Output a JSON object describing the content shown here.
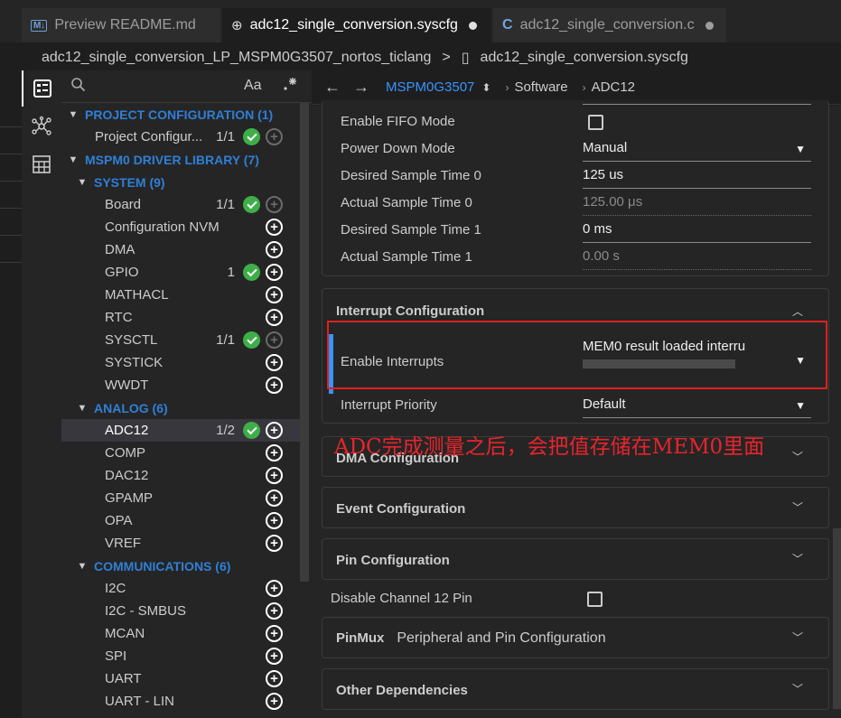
{
  "tabs": [
    {
      "label": "Preview README.md",
      "icon": "markdown-icon",
      "active": false
    },
    {
      "label": "adc12_single_conversion.syscfg",
      "icon": "globe-icon",
      "active": true,
      "modified": true
    },
    {
      "label": "adc12_single_conversion.c",
      "icon": "c-file-icon",
      "active": false,
      "modified": true
    }
  ],
  "breadcrumb": {
    "folder": "adc12_single_conversion_LP_MSPM0G3507_nortos_ticlang",
    "separator": ">",
    "file": "adc12_single_conversion.syscfg"
  },
  "sidebar": {
    "search_placeholder": "",
    "match_case_label": "Aa",
    "tree": [
      {
        "label": "PROJECT CONFIGURATION (1)",
        "type": "header",
        "level": 0,
        "expanded": true
      },
      {
        "label": "Project Configur...",
        "level": 1,
        "count": "1/1",
        "ok": true,
        "plus_dim": true
      },
      {
        "label": "MSPM0 DRIVER LIBRARY (7)",
        "type": "header",
        "level": 0,
        "expanded": true
      },
      {
        "label": "SYSTEM (9)",
        "type": "header",
        "level": 1,
        "expanded": true
      },
      {
        "label": "Board",
        "level": 2,
        "count": "1/1",
        "ok": true,
        "plus_dim": true
      },
      {
        "label": "Configuration NVM",
        "level": 2
      },
      {
        "label": "DMA",
        "level": 2
      },
      {
        "label": "GPIO",
        "level": 2,
        "count": "1",
        "ok": true
      },
      {
        "label": "MATHACL",
        "level": 2
      },
      {
        "label": "RTC",
        "level": 2
      },
      {
        "label": "SYSCTL",
        "level": 2,
        "count": "1/1",
        "ok": true,
        "plus_dim": true
      },
      {
        "label": "SYSTICK",
        "level": 2
      },
      {
        "label": "WWDT",
        "level": 2
      },
      {
        "label": "ANALOG (6)",
        "type": "header",
        "level": 1,
        "expanded": true
      },
      {
        "label": "ADC12",
        "level": 2,
        "count": "1/2",
        "ok": true,
        "selected": true
      },
      {
        "label": "COMP",
        "level": 2
      },
      {
        "label": "DAC12",
        "level": 2
      },
      {
        "label": "GPAMP",
        "level": 2
      },
      {
        "label": "OPA",
        "level": 2
      },
      {
        "label": "VREF",
        "level": 2
      },
      {
        "label": "COMMUNICATIONS (6)",
        "type": "header",
        "level": 1,
        "expanded": true
      },
      {
        "label": "I2C",
        "level": 2
      },
      {
        "label": "I2C - SMBUS",
        "level": 2
      },
      {
        "label": "MCAN",
        "level": 2
      },
      {
        "label": "SPI",
        "level": 2
      },
      {
        "label": "UART",
        "level": 2
      },
      {
        "label": "UART - LIN",
        "level": 2
      }
    ]
  },
  "toolbar": {
    "device": "MSPM0G3507",
    "crumb1": "Software",
    "crumb2": "ADC12"
  },
  "adc_fields": [
    {
      "label": "Enable FIFO Mode",
      "kind": "checkbox",
      "checked": false
    },
    {
      "label": "Power Down Mode",
      "kind": "dropdown",
      "value": "Manual"
    },
    {
      "label": "Desired Sample Time 0",
      "kind": "input",
      "value": "125 us"
    },
    {
      "label": "Actual Sample Time 0",
      "kind": "readonly",
      "value": "125.00 μs"
    },
    {
      "label": "Desired Sample Time 1",
      "kind": "input",
      "value": "0 ms"
    },
    {
      "label": "Actual Sample Time 1",
      "kind": "readonly",
      "value": "0.00 s"
    }
  ],
  "interrupt": {
    "title": "Interrupt Configuration",
    "enable_label": "Enable Interrupts",
    "enable_value": "MEM0 result loaded interru",
    "priority_label": "Interrupt Priority",
    "priority_value": "Default"
  },
  "annotation": "ADC完成测量之后，会把值存储在MEM0里面",
  "sections": {
    "dma": "DMA Configuration",
    "event": "Event Configuration",
    "pin": "Pin Configuration",
    "disable_ch12": "Disable Channel 12 Pin",
    "pinmux_tag": "PinMux",
    "pinmux": "Peripheral and Pin Configuration",
    "other": "Other Dependencies"
  },
  "colors": {
    "accent": "#3794ff",
    "header_blue": "#2f7fd6",
    "ok_green": "#3fae49",
    "annotation_red": "#e8242a"
  }
}
